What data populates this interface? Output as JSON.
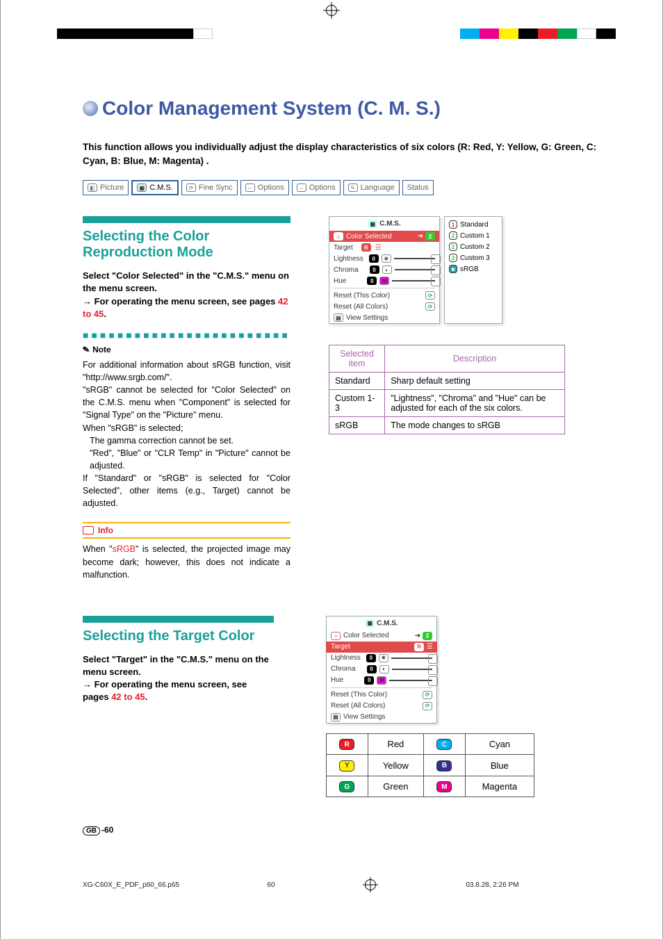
{
  "page_title": "Color Management System (C. M. S.)",
  "intro": "This function allows you individually adjust the display characteristics of six colors (R: Red, Y: Yellow, G: Green, C: Cyan, B: Blue, M: Magenta) .",
  "menu_tabs": {
    "picture": "Picture",
    "cms": "C.M.S.",
    "fine_sync": "Fine Sync",
    "options1": "Options",
    "options2": "Options",
    "language": "Language",
    "status": "Status"
  },
  "section1": {
    "heading": "Selecting the Color Reproduction Mode",
    "instruction1": "Select \"Color Selected\" in the \"C.M.S.\" menu on the menu screen.",
    "instruction2_arrow": "→",
    "instruction2": " For operating the menu screen, see pages ",
    "page_ref": "42 to 45",
    "period": "."
  },
  "note": {
    "label": "Note",
    "p1_a": "For additional information about sRGB function, visit \"http://www.srgb.com/\".",
    "p2": "\"sRGB\" cannot be selected for \"Color Selected\" on the C.M.S. menu when \"Component\" is selected for \"Signal Type\" on the \"Picture\" menu.",
    "p3": "When \"sRGB\" is selected;",
    "p3a": "The gamma correction cannot be set.",
    "p3b": "\"Red\", \"Blue\" or \"CLR Temp\" in \"Picture\" cannot be adjusted.",
    "p4": "If \"Standard\" or \"sRGB\" is selected for \"Color Selected\", other items (e.g., Target) cannot be adjusted."
  },
  "info": {
    "label": "Info",
    "text_a": "When \"",
    "srgb": "sRGB",
    "text_b": "\" is selected, the projected image may become dark; however, this does not indicate a malfunction."
  },
  "osd1": {
    "title": "C.M.S.",
    "row_color_selected": "Color Selected",
    "target": "Target",
    "lightness": "Lightness",
    "chroma": "Chroma",
    "hue": "Hue",
    "zero": "0",
    "reset_this": "Reset (This Color)",
    "reset_all": "Reset (All Colors)",
    "view_settings": "View Settings",
    "badge_r": "R"
  },
  "side_options": {
    "standard": "Standard",
    "custom1": "Custom 1",
    "custom2": "Custom 2",
    "custom3": "Custom 3",
    "srgb": "sRGB"
  },
  "desc_table": {
    "h1": "Selected item",
    "h2": "Description",
    "r1c1": "Standard",
    "r1c2": "Sharp default setting",
    "r2c1": "Custom 1-3",
    "r2c2": "\"Lightness\", \"Chroma\" and \"Hue\" can be adjusted for each of the six colors.",
    "r3c1": "sRGB",
    "r3c2": "The mode changes to sRGB"
  },
  "section2": {
    "heading": "Selecting the Target Color",
    "instruction1": "Select \"Target\" in the \"C.M.S.\" menu on the menu screen.",
    "instruction2_arrow": "→",
    "instruction2": " For operating the menu screen, see pages ",
    "page_ref": "42 to 45",
    "period": "."
  },
  "color_legend": {
    "r": {
      "letter": "R",
      "name": "Red",
      "color": "#ed1c24"
    },
    "y": {
      "letter": "Y",
      "name": "Yellow",
      "color": "#fff200"
    },
    "g": {
      "letter": "G",
      "name": "Green",
      "color": "#00a651"
    },
    "c": {
      "letter": "C",
      "name": "Cyan",
      "color": "#00aeef"
    },
    "b": {
      "letter": "B",
      "name": "Blue",
      "color": "#2e3192"
    },
    "m": {
      "letter": "M",
      "name": "Magenta",
      "color": "#ec008c"
    }
  },
  "page_marker": {
    "gb": "GB",
    "num": "-60"
  },
  "footer": {
    "filename": "XG-C60X_E_PDF_p60_66.p65",
    "page": "60",
    "timestamp": "03.8.28, 2:26 PM"
  }
}
